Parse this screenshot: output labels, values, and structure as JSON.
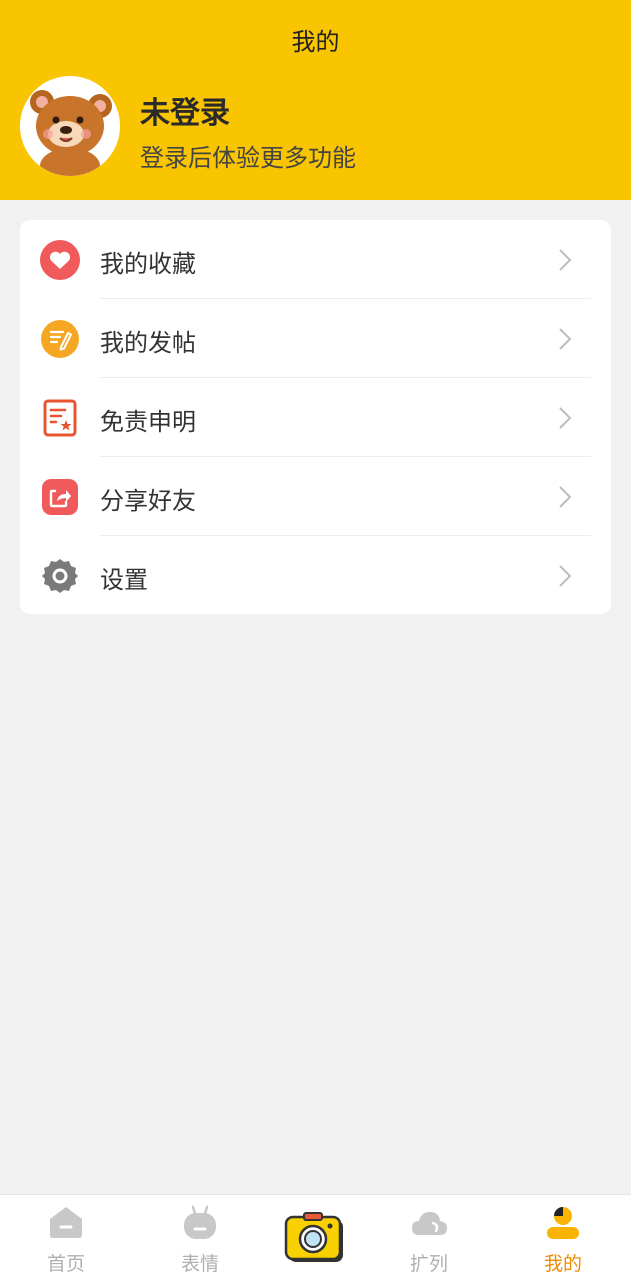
{
  "header": {
    "title": "我的",
    "login_title": "未登录",
    "login_subtitle": "登录后体验更多功能",
    "background_color": "#f9c400"
  },
  "menu": {
    "items": [
      {
        "label": "我的收藏",
        "icon": "heart-icon",
        "color": "#f05a5a"
      },
      {
        "label": "我的发帖",
        "icon": "pencil-note-icon",
        "color": "#f5a623"
      },
      {
        "label": "免责申明",
        "icon": "document-icon",
        "color": "#e8542e"
      },
      {
        "label": "分享好友",
        "icon": "share-icon",
        "color": "#f05a5a"
      },
      {
        "label": "设置",
        "icon": "gear-icon",
        "color": "#7a7a7a"
      }
    ]
  },
  "tabbar": {
    "tabs": [
      {
        "label": "首页",
        "icon": "home-icon",
        "active": false
      },
      {
        "label": "表情",
        "icon": "emoji-icon",
        "active": false
      },
      {
        "label": "",
        "icon": "camera-icon",
        "active": false
      },
      {
        "label": "扩列",
        "icon": "cloud-icon",
        "active": false
      },
      {
        "label": "我的",
        "icon": "profile-icon",
        "active": true
      }
    ],
    "active_color": "#f08c00",
    "inactive_color": "#b0b0b0"
  }
}
